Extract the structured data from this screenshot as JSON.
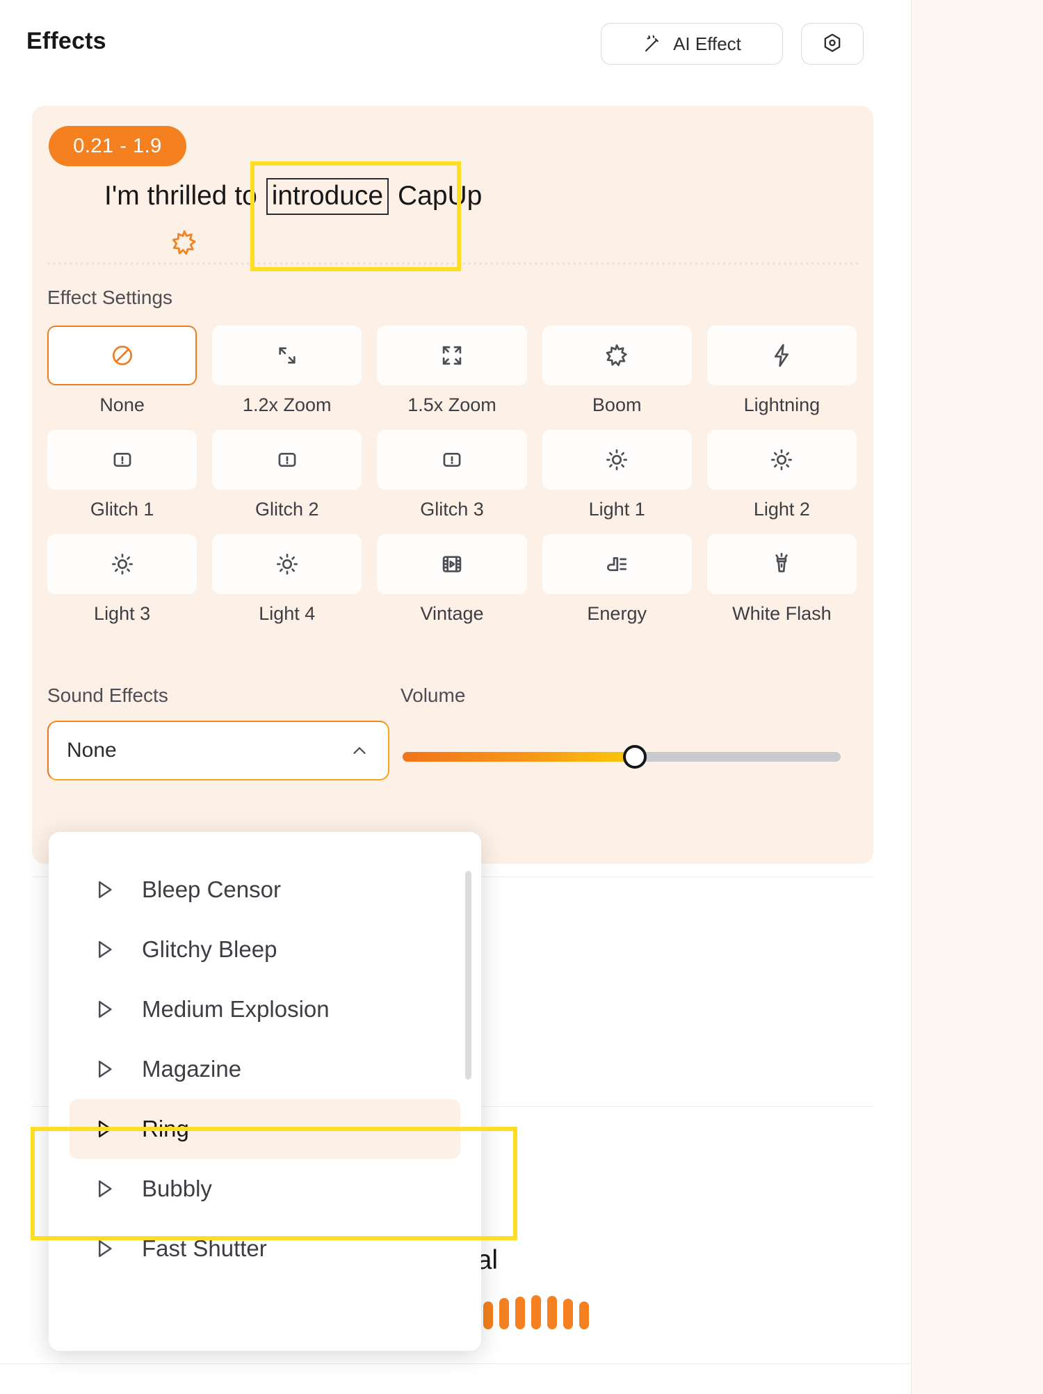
{
  "header": {
    "title": "Effects",
    "ai_effect_label": "AI Effect",
    "ai_effect_icon": "magic-wand-icon",
    "settings_icon": "hexagon-settings-icon"
  },
  "effect_card": {
    "time_badge": "0.21 - 1.9",
    "caption": {
      "before": "I'm thrilled to ",
      "highlighted_word": "introduce",
      "after": " CapUp"
    },
    "caption_icon": "boom-star-icon",
    "effect_settings_label": "Effect Settings",
    "effects": [
      {
        "label": "None",
        "icon": "no-entry-icon",
        "selected": true
      },
      {
        "label": "1.2x Zoom",
        "icon": "zoom-in-diagonal-icon",
        "selected": false
      },
      {
        "label": "1.5x Zoom",
        "icon": "expand-corners-icon",
        "selected": false
      },
      {
        "label": "Boom",
        "icon": "burst-star-icon",
        "selected": false
      },
      {
        "label": "Lightning",
        "icon": "lightning-bolt-icon",
        "selected": false
      },
      {
        "label": "Glitch 1",
        "icon": "alert-box-icon",
        "selected": false
      },
      {
        "label": "Glitch 2",
        "icon": "alert-box-icon",
        "selected": false
      },
      {
        "label": "Glitch 3",
        "icon": "alert-box-icon",
        "selected": false
      },
      {
        "label": "Light 1",
        "icon": "sun-icon",
        "selected": false
      },
      {
        "label": "Light 2",
        "icon": "sun-icon",
        "selected": false
      },
      {
        "label": "Light 3",
        "icon": "sun-icon",
        "selected": false
      },
      {
        "label": "Light 4",
        "icon": "sun-icon",
        "selected": false
      },
      {
        "label": "Vintage",
        "icon": "film-strip-icon",
        "selected": false
      },
      {
        "label": "Energy",
        "icon": "energy-speed-icon",
        "selected": false
      },
      {
        "label": "White Flash",
        "icon": "flashlight-icon",
        "selected": false
      }
    ],
    "sound_effects_label": "Sound Effects",
    "sound_effects_value": "None",
    "sound_effects_chevron": "chevron-up-icon",
    "volume_label": "Volume",
    "volume_percent": 53
  },
  "sound_dropdown": {
    "open": true,
    "items": [
      {
        "label": "Bleep Censor",
        "icon": "play-triangle-icon",
        "active": false
      },
      {
        "label": "Glitchy Bleep",
        "icon": "play-triangle-icon",
        "active": false
      },
      {
        "label": "Medium Explosion",
        "icon": "play-triangle-icon",
        "active": false
      },
      {
        "label": "Magazine",
        "icon": "play-triangle-icon",
        "active": false
      },
      {
        "label": "Ring",
        "icon": "play-triangle-icon",
        "active": true
      },
      {
        "label": "Bubbly",
        "icon": "play-triangle-icon",
        "active": false
      },
      {
        "label": "Fast Shutter",
        "icon": "play-triangle-icon",
        "active": false
      }
    ]
  },
  "background": {
    "partial_text": "tential"
  },
  "annotations": {
    "word_box_target": "introduce",
    "ring_box_target": "Ring",
    "color": "#ffdd22"
  },
  "colors": {
    "accent_orange": "#f5801f",
    "card_bg": "#fdf1e7",
    "selected_border": "#ef7d20",
    "highlight_yellow": "#ffdd22"
  }
}
